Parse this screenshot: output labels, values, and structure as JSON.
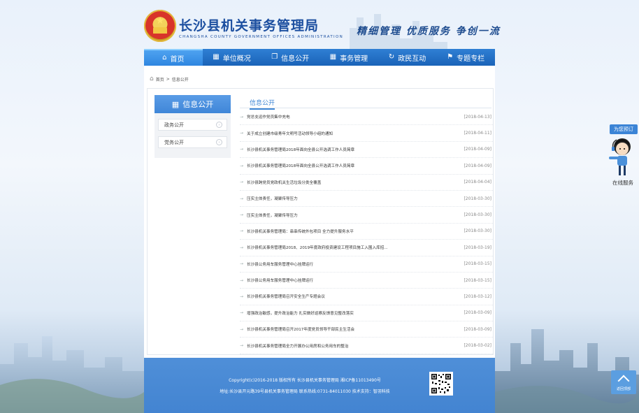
{
  "header": {
    "title": "长沙县机关事务管理局",
    "subtitle": "CHANGSHA COUNTY GOVERNMENT OFFICES ADMINISTRATION",
    "slogan": "精细管理 优质服务 争创一流"
  },
  "nav": [
    {
      "label": "首页",
      "icon": "home-icon"
    },
    {
      "label": "单位概况",
      "icon": "calendar-icon"
    },
    {
      "label": "信息公开",
      "icon": "book-icon"
    },
    {
      "label": "事务管理",
      "icon": "grid-icon"
    },
    {
      "label": "政民互动",
      "icon": "refresh-icon"
    },
    {
      "label": "专题专栏",
      "icon": "flag-icon"
    }
  ],
  "breadcrumb": {
    "home": "首页",
    "sep": ">",
    "current": "信息公开"
  },
  "sidebar": {
    "heading": "信息公开",
    "items": [
      "政务公开",
      "党务公开"
    ]
  },
  "list": {
    "heading": "信息公开",
    "items": [
      {
        "title": "党总支运作党员集中充电",
        "date": "[2018-04-13]"
      },
      {
        "title": "关于成立创建市级青年文明号活动领导小组的通知",
        "date": "[2018-04-11]"
      },
      {
        "title": "长沙县机关事务管理局2018年面向全县公开选调工作人员简章",
        "date": "[2018-04-09]"
      },
      {
        "title": "长沙县机关事务管理局2018年面向全县公开选调工作人员简章",
        "date": "[2018-04-09]"
      },
      {
        "title": "长沙县跨党员党政机关生活垃圾分类全覆盖",
        "date": "[2018-04-04]"
      },
      {
        "title": "压实主体责任，凝聚传导压力",
        "date": "[2018-03-30]"
      },
      {
        "title": "压实主体责任，凝聚传导压力",
        "date": "[2018-03-30]"
      },
      {
        "title": "长沙县机关事务管理局：串串传统外包项目 全力提升服务水平",
        "date": "[2018-03-30]"
      },
      {
        "title": "长沙县机关事务管理局2018、2019年度政府投资建设工程项目施工入围入库招...",
        "date": "[2018-03-19]"
      },
      {
        "title": "长沙县公务用车服务管理中心挂牌运行",
        "date": "[2018-03-15]"
      },
      {
        "title": "长沙县公务用车服务管理中心挂牌运行",
        "date": "[2018-03-15]"
      },
      {
        "title": "长沙县机关事务管理局召开安全生产专题会议",
        "date": "[2018-03-12]"
      },
      {
        "title": "增强政治敏感，提升政治能力 扎实做好巡察反馈意见整改落实",
        "date": "[2018-03-09]"
      },
      {
        "title": "长沙县机关事务管理局召开2017年度党员领导干部民主生活会",
        "date": "[2018-03-09]"
      },
      {
        "title": "长沙县机关事务管理局全力开展办公用房和公务用车的整治",
        "date": "[2018-03-02]"
      }
    ]
  },
  "footer": {
    "line1": "Copyright(c)2016-2018 版权所有 长沙县机关事务管理局 湘ICP备11013490号",
    "line2": "地址:长沙县开元路39号县机关事务管理局 联系热线:0731-84011030 技术支持：智羽科技"
  },
  "widgets": {
    "service_tag": "为您预订",
    "service_label": "在线服务",
    "back_top": "返回顶部"
  },
  "colors": {
    "primary": "#1a63b8",
    "accent": "#3e86d4",
    "footer": "#4a8ad4"
  }
}
